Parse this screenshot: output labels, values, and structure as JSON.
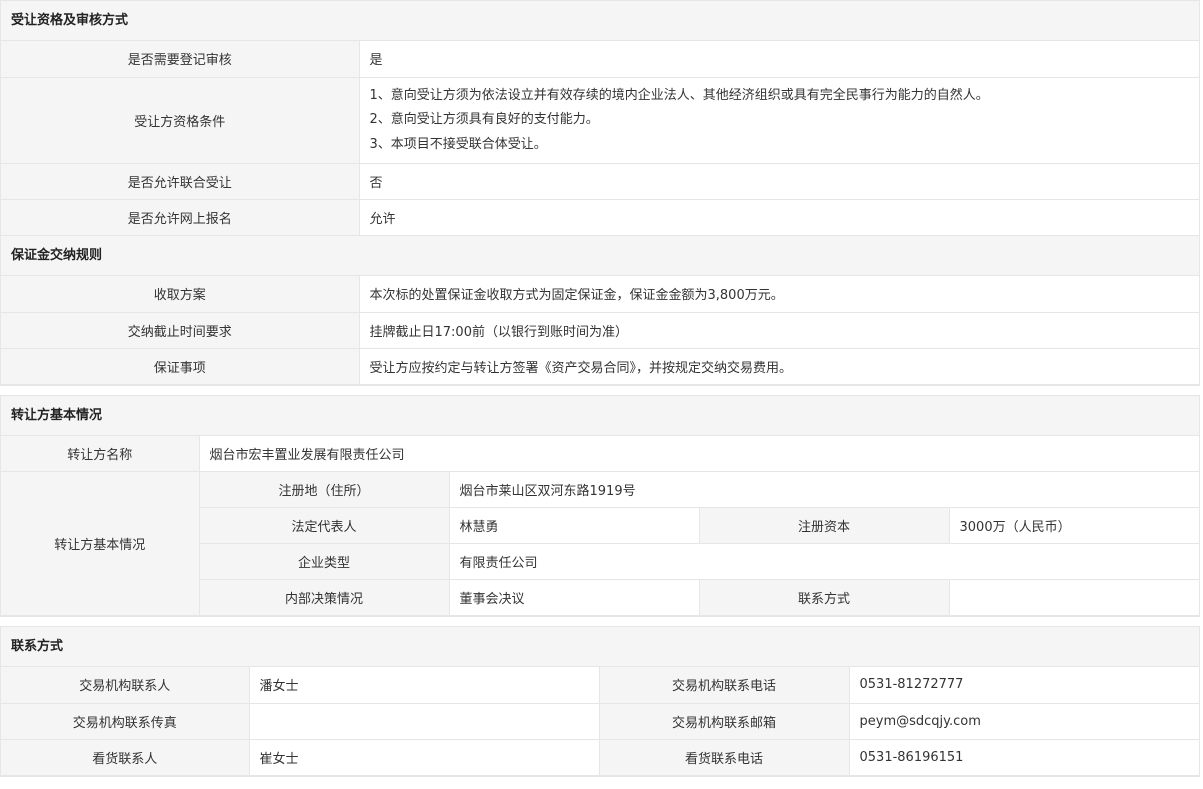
{
  "section1": {
    "title": "受让资格及审核方式",
    "rows": [
      {
        "label": "是否需要登记审核",
        "value": "是"
      },
      {
        "label": "受让方资格条件",
        "lines": [
          "1、意向受让方须为依法设立并有效存续的境内企业法人、其他经济组织或具有完全民事行为能力的自然人。",
          "2、意向受让方须具有良好的支付能力。",
          "3、本项目不接受联合体受让。"
        ]
      },
      {
        "label": "是否允许联合受让",
        "value": "否"
      },
      {
        "label": "是否允许网上报名",
        "value": "允许"
      }
    ]
  },
  "section2": {
    "title": "保证金交纳规则",
    "rows": [
      {
        "label": "收取方案",
        "value": "本次标的处置保证金收取方式为固定保证金，保证金金额为3,800万元。"
      },
      {
        "label": "交纳截止时间要求",
        "value": "挂牌截止日17:00前（以银行到账时间为准）"
      },
      {
        "label": "保证事项",
        "value": "受让方应按约定与转让方签署《资产交易合同》，并按规定交纳交易费用。"
      }
    ]
  },
  "section3": {
    "title": "转让方基本情况",
    "name_label": "转让方名称",
    "name_value": "烟台市宏丰置业发展有限责任公司",
    "info_label": "转让方基本情况",
    "address_label": "注册地（住所）",
    "address_value": "烟台市莱山区双河东路1919号",
    "legal_rep_label": "法定代表人",
    "legal_rep_value": "林慧勇",
    "capital_label": "注册资本",
    "capital_value": "3000万（人民币）",
    "type_label": "企业类型",
    "type_value": "有限责任公司",
    "decision_label": "内部决策情况",
    "decision_value": "董事会决议",
    "contact_label": "联系方式",
    "contact_value": ""
  },
  "section4": {
    "title": "联系方式",
    "contact_person_label": "交易机构联系人",
    "contact_person_value": "潘女士",
    "contact_phone_label": "交易机构联系电话",
    "contact_phone_value": "0531-81272777",
    "fax_label": "交易机构联系传真",
    "fax_value": "",
    "email_label": "交易机构联系邮箱",
    "email_value": "peym@sdcqjy.com",
    "viewing_person_label": "看货联系人",
    "viewing_person_value": "崔女士",
    "viewing_phone_label": "看货联系电话",
    "viewing_phone_value": "0531-86196151"
  }
}
